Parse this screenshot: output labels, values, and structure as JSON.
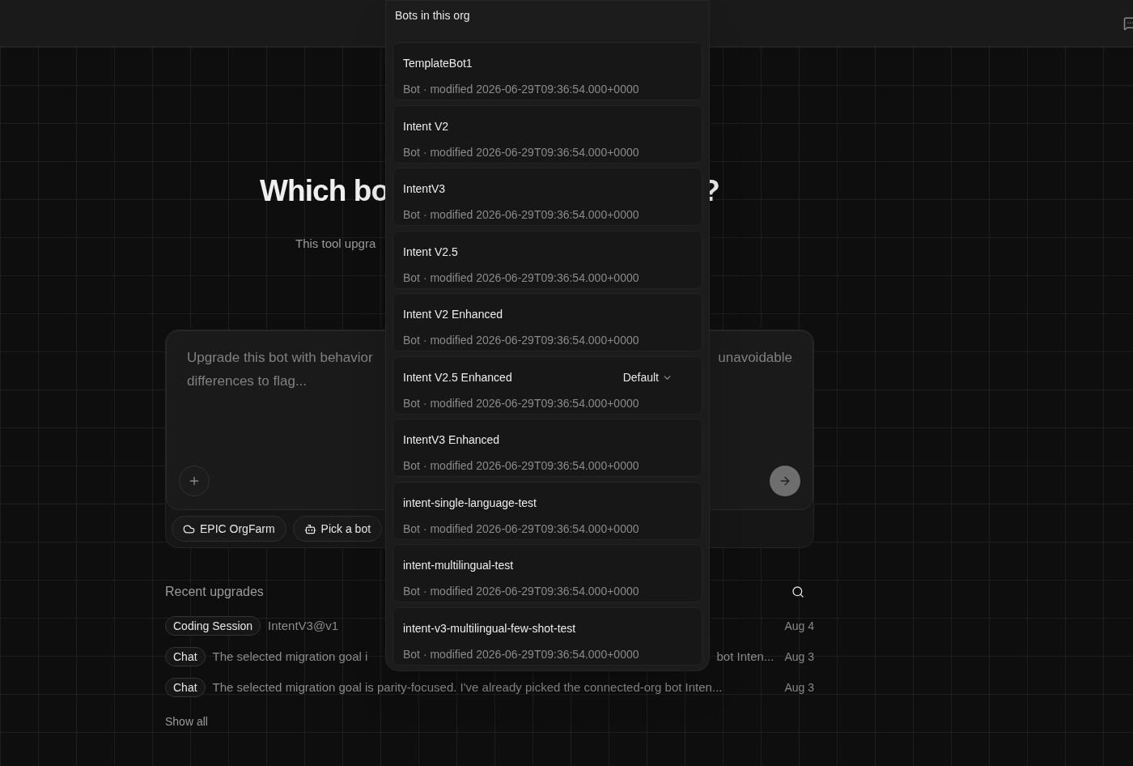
{
  "heading": {
    "visible_parts": [
      "Which bo",
      "?"
    ]
  },
  "subtitle": {
    "visible_part": "This tool upgra"
  },
  "composer": {
    "placeholder_lines": [
      [
        "Upgrade this bot with behavior",
        "unavoidable"
      ],
      [
        "differences to flag..."
      ]
    ],
    "chips": [
      {
        "label": "EPIC OrgFarm",
        "kind": "org"
      },
      {
        "label": "Pick a bot",
        "kind": "bot"
      }
    ]
  },
  "recent": {
    "title": "Recent upgrades",
    "items": [
      {
        "tag": "Coding Session",
        "text_parts": [
          "IntentV3@v1"
        ],
        "date": "Aug 4"
      },
      {
        "tag": "Chat",
        "text_parts": [
          "The selected migration goal i",
          "bot Inten..."
        ],
        "date": "Aug 3"
      },
      {
        "tag": "Chat",
        "text_parts": [
          "The selected migration goal is parity-focused. I've already picked the connected-org bot Inten..."
        ],
        "date": "Aug 3"
      }
    ],
    "show_all": "Show all"
  },
  "dropdown": {
    "title": "Bots in this org",
    "bots": [
      {
        "name": "TemplateBot1",
        "meta": "Bot · modified 2026-06-29T09:36:54.000+0000"
      },
      {
        "name": "Intent V2",
        "meta": "Bot · modified 2026-06-29T09:36:54.000+0000"
      },
      {
        "name": "IntentV3",
        "meta": "Bot · modified 2026-06-29T09:36:54.000+0000"
      },
      {
        "name": "Intent V2.5",
        "meta": "Bot · modified 2026-06-29T09:36:54.000+0000"
      },
      {
        "name": "Intent V2 Enhanced",
        "meta": "Bot · modified 2026-06-29T09:36:54.000+0000"
      },
      {
        "name": "Intent V2.5 Enhanced",
        "meta": "Bot · modified 2026-06-29T09:36:54.000+0000",
        "tag": "Default"
      },
      {
        "name": "IntentV3 Enhanced",
        "meta": "Bot · modified 2026-06-29T09:36:54.000+0000"
      },
      {
        "name": "intent-single-language-test",
        "meta": "Bot · modified 2026-06-29T09:36:54.000+0000"
      },
      {
        "name": "intent-multilingual-test",
        "meta": "Bot · modified 2026-06-29T09:36:54.000+0000"
      },
      {
        "name": "intent-v3-multilingual-few-shot-test",
        "meta": "Bot · modified 2026-06-29T09:36:54.000+0000"
      }
    ]
  }
}
